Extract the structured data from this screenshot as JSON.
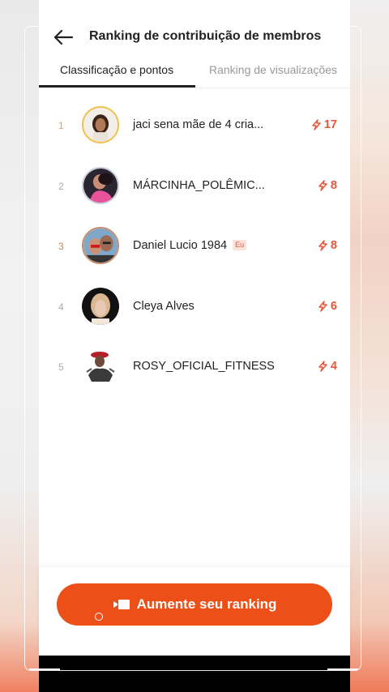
{
  "header": {
    "title": "Ranking de contribuição de membros"
  },
  "tabs": [
    {
      "label": "Classificação e pontos",
      "active": true
    },
    {
      "label": "Ranking de visualizações",
      "active": false
    }
  ],
  "members": [
    {
      "rank": "1",
      "name": "jaci sena mãe de 4 cria...",
      "points": "17",
      "rank_color": "#e9a23b",
      "ring": "#f0c14b",
      "is_me": false
    },
    {
      "rank": "2",
      "name": "MÁRCINHA_POLÊMIC...",
      "points": "8",
      "rank_color": "#aaaaaa",
      "ring": "#c9cfd8",
      "is_me": false
    },
    {
      "rank": "3",
      "name": "Daniel Lucio 1984",
      "points": "8",
      "rank_color": "#d8874f",
      "ring": "#c98c6e",
      "is_me": true
    },
    {
      "rank": "4",
      "name": "Cleya Alves",
      "points": "6",
      "rank_color": "#aaaaaa",
      "ring": "none",
      "is_me": false
    },
    {
      "rank": "5",
      "name": "ROSY_OFICIAL_FITNESS",
      "points": "4",
      "rank_color": "#aaaaaa",
      "ring": "none",
      "is_me": false
    }
  ],
  "me_badge": "Eu",
  "cta": {
    "label": "Aumente seu ranking"
  },
  "colors": {
    "accent": "#ed4f18",
    "points": "#e8563a"
  }
}
